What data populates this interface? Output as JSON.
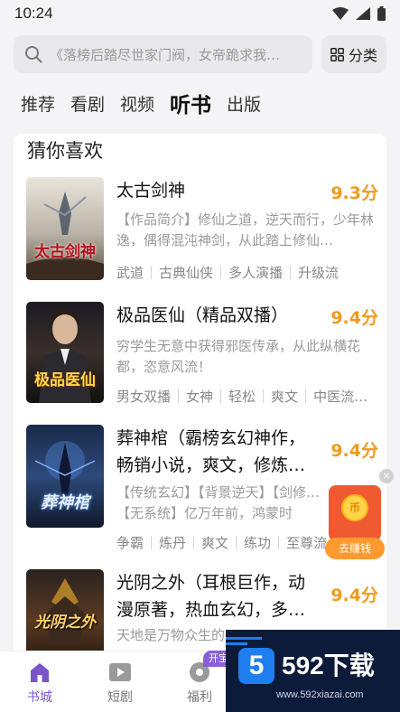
{
  "status_bar": {
    "time": "10:24"
  },
  "search": {
    "placeholder": "《落榜后踏尽世家门阀，女帝跪求我…",
    "category_label": "分类"
  },
  "tabs": [
    {
      "label": "推荐",
      "active": false
    },
    {
      "label": "看剧",
      "active": false
    },
    {
      "label": "视频",
      "active": false
    },
    {
      "label": "听书",
      "active": true
    },
    {
      "label": "出版",
      "active": false
    }
  ],
  "section": {
    "title": "猜你喜欢"
  },
  "books": [
    {
      "title": "太古剑神",
      "score": "9.3分",
      "cover_text": "太古剑神",
      "description": "【作品简介】修仙之道，逆天而行，少年林逸，偶得混沌神剑，从此踏上修仙…",
      "tags": [
        "武道",
        "古典仙侠",
        "多人演播",
        "升级流"
      ]
    },
    {
      "title": "极品医仙（精品双播）",
      "score": "9.4分",
      "cover_text": "极品医仙",
      "description": "穷学生无意中获得邪医传承，从此纵横花都，恣意风流！",
      "tags": [
        "男女双播",
        "女神",
        "轻松",
        "爽文",
        "中医流…"
      ]
    },
    {
      "title": "葬神棺（霸榜玄幻神作，畅销小说，爽文，修炼…",
      "score": "9.4分",
      "cover_text": "葬神棺",
      "description": "【传统玄幻】【背景逆天】【剑修…【无系统】亿万年前，鸿蒙时代，…",
      "tags": [
        "争霸",
        "炼丹",
        "爽文",
        "练功",
        "至尊流"
      ]
    },
    {
      "title": "光阴之外（耳根巨作，动漫原著，热血玄幻，多…",
      "score": "9.4分",
      "cover_text": "光阴之外",
      "description": "天地是万物众生的",
      "tags": []
    }
  ],
  "float_reward": {
    "label": "去赚钱",
    "coin": "币"
  },
  "bottom_nav": [
    {
      "label": "书城",
      "icon": "house-icon",
      "active": true
    },
    {
      "label": "短剧",
      "icon": "play-icon",
      "active": false
    },
    {
      "label": "福利",
      "icon": "gift-icon",
      "active": false
    }
  ],
  "badge": "开宝",
  "watermark": {
    "logo": "5",
    "brand": "592下载",
    "url": "www.592xiazai.com"
  },
  "colors": {
    "accent": "#7a55c9",
    "score": "#f29a1f",
    "reward": "#ef5a31"
  }
}
